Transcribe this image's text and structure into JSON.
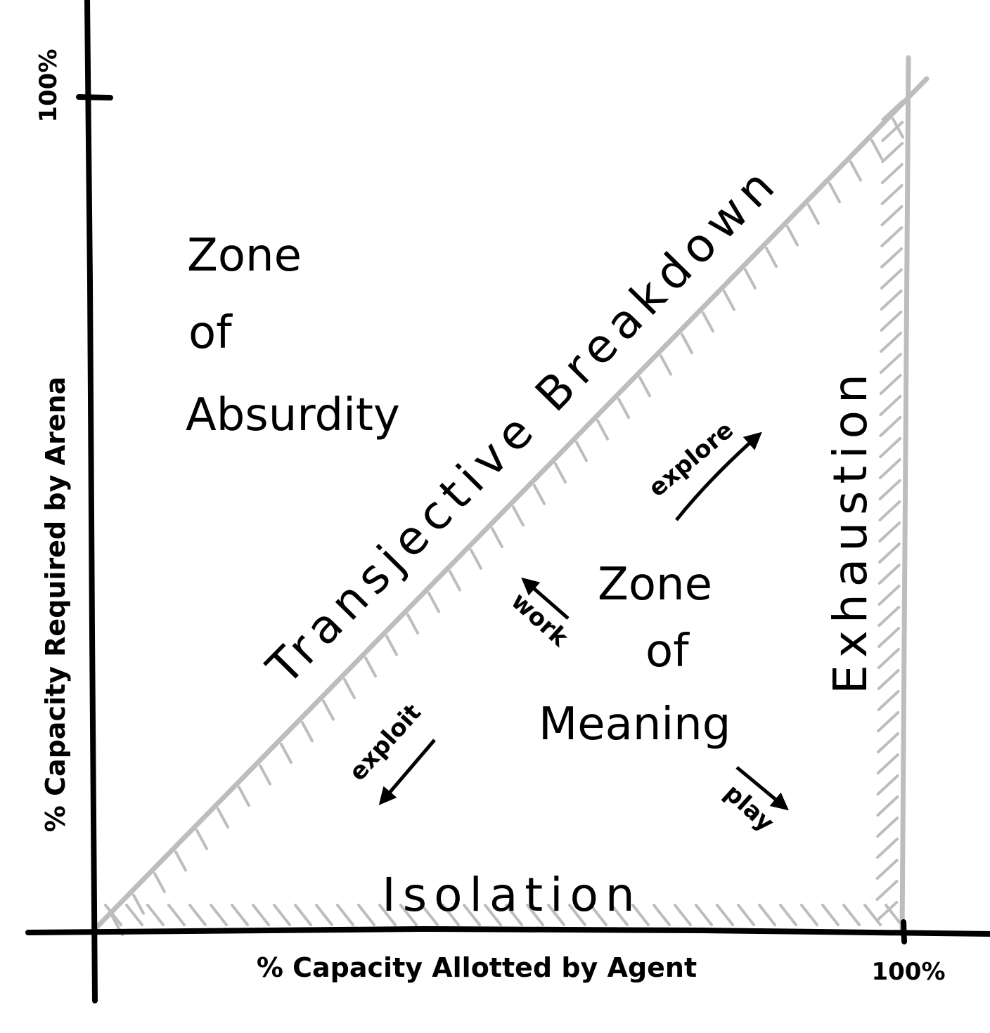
{
  "axes": {
    "x_label": "% Capacity Allotted by Agent",
    "y_label": "% Capacity Required by Arena",
    "x_tick": "100%",
    "y_tick": "100%"
  },
  "zones": {
    "absurdity": [
      "Zone",
      "of",
      "Absurdity"
    ],
    "meaning": [
      "Zone",
      "of",
      "Meaning"
    ]
  },
  "boundaries": {
    "diagonal": "Transjective Breakdown",
    "right": "Exhaustion",
    "bottom": "Isolation"
  },
  "arrows": {
    "explore": "explore",
    "work": "work",
    "exploit": "exploit",
    "play": "play"
  },
  "colors": {
    "ink": "#000000",
    "boundary": "#bdbdbd"
  }
}
